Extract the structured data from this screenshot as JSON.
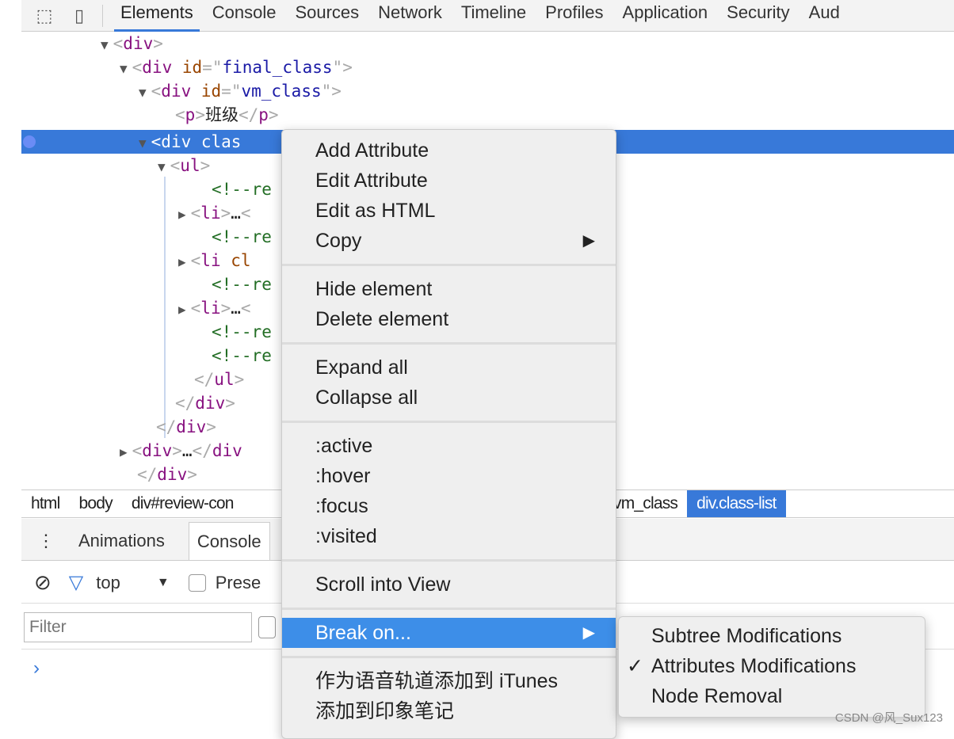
{
  "toolbar": {
    "tabs": [
      "Elements",
      "Console",
      "Sources",
      "Network",
      "Timeline",
      "Profiles",
      "Application",
      "Security",
      "Aud"
    ],
    "active": "Elements"
  },
  "tree": {
    "rows": [
      {
        "parts": [
          [
            "tri",
            "▼"
          ],
          [
            "br",
            "<"
          ],
          [
            "tag",
            "div"
          ],
          [
            "br",
            ">"
          ]
        ]
      },
      {
        "parts": [
          [
            "tri",
            "▼"
          ],
          [
            "br",
            "<"
          ],
          [
            "tag",
            "div "
          ],
          [
            "attr",
            "id"
          ],
          [
            "br",
            "=\""
          ],
          [
            "val",
            "final_class"
          ],
          [
            "br",
            "\">"
          ]
        ]
      },
      {
        "parts": [
          [
            "tri",
            "▼"
          ],
          [
            "br",
            "<"
          ],
          [
            "tag",
            "div "
          ],
          [
            "attr",
            "id"
          ],
          [
            "br",
            "=\""
          ],
          [
            "val",
            "vm_class"
          ],
          [
            "br",
            "\">"
          ]
        ]
      },
      {
        "parts": [
          [
            "br",
            "<"
          ],
          [
            "tag",
            "p"
          ],
          [
            "br",
            ">"
          ],
          [
            "txt",
            "班级"
          ],
          [
            "br",
            "</"
          ],
          [
            "tag",
            "p"
          ],
          [
            "br",
            ">"
          ]
        ]
      },
      {
        "parts": [
          [
            "tri",
            "▼"
          ],
          [
            "br",
            "<"
          ],
          [
            "tag",
            "div "
          ],
          [
            "attr",
            "clas"
          ]
        ]
      },
      {
        "parts": [
          [
            "tri",
            "▼"
          ],
          [
            "br",
            "<"
          ],
          [
            "tag",
            "ul"
          ],
          [
            "br",
            ">"
          ]
        ]
      },
      {
        "parts": [
          [
            "cm",
            "<!--re"
          ]
        ]
      },
      {
        "parts": [
          [
            "tri",
            "▶"
          ],
          [
            "br",
            "<"
          ],
          [
            "tag",
            "li"
          ],
          [
            "br",
            ">"
          ],
          [
            "txt",
            "…"
          ],
          [
            "br",
            "<"
          ]
        ]
      },
      {
        "parts": [
          [
            "cm",
            "<!--re"
          ]
        ]
      },
      {
        "parts": [
          [
            "tri",
            "▶"
          ],
          [
            "br",
            "<"
          ],
          [
            "tag",
            "li "
          ],
          [
            "attr",
            "cl"
          ]
        ]
      },
      {
        "parts": [
          [
            "cm",
            "<!--re"
          ]
        ]
      },
      {
        "parts": [
          [
            "tri",
            "▶"
          ],
          [
            "br",
            "<"
          ],
          [
            "tag",
            "li"
          ],
          [
            "br",
            ">"
          ],
          [
            "txt",
            "…"
          ],
          [
            "br",
            "<"
          ]
        ]
      },
      {
        "parts": [
          [
            "cm",
            "<!--re"
          ]
        ]
      },
      {
        "parts": [
          [
            "cm",
            "<!--re"
          ]
        ]
      },
      {
        "parts": [
          [
            "br",
            "</"
          ],
          [
            "tag",
            "ul"
          ],
          [
            "br",
            ">"
          ]
        ]
      },
      {
        "parts": [
          [
            "br",
            "</"
          ],
          [
            "tag",
            "div"
          ],
          [
            "br",
            ">"
          ]
        ]
      },
      {
        "parts": [
          [
            "br",
            "</"
          ],
          [
            "tag",
            "div"
          ],
          [
            "br",
            ">"
          ]
        ]
      },
      {
        "parts": [
          [
            "tri",
            "▶"
          ],
          [
            "br",
            "<"
          ],
          [
            "tag",
            "div"
          ],
          [
            "br",
            ">"
          ],
          [
            "txt",
            "…"
          ],
          [
            "br",
            "</"
          ],
          [
            "tag",
            "div"
          ]
        ]
      },
      {
        "parts": [
          [
            "br",
            "</"
          ],
          [
            "tag",
            "div"
          ],
          [
            "br",
            ">"
          ]
        ]
      }
    ]
  },
  "breadcrumbs": [
    "html",
    "body",
    "div#review-con",
    "div#vm_class",
    "div.class-list"
  ],
  "drawer": {
    "tabs": [
      "Animations",
      "Console"
    ],
    "active": "Console"
  },
  "console_toolbar": {
    "context": "top",
    "preserve_label": "Prese"
  },
  "filter": {
    "placeholder": "Filter",
    "value": ""
  },
  "context_menu": {
    "groups": [
      [
        {
          "label": "Add Attribute"
        },
        {
          "label": "Edit Attribute"
        },
        {
          "label": "Edit as HTML"
        },
        {
          "label": "Copy",
          "submenu": true
        }
      ],
      [
        {
          "label": "Hide element"
        },
        {
          "label": "Delete element"
        }
      ],
      [
        {
          "label": "Expand all"
        },
        {
          "label": "Collapse all"
        }
      ],
      [
        {
          "label": ":active"
        },
        {
          "label": ":hover"
        },
        {
          "label": ":focus"
        },
        {
          "label": ":visited"
        }
      ],
      [
        {
          "label": "Scroll into View"
        }
      ],
      [
        {
          "label": "Break on...",
          "submenu": true,
          "highlighted": true
        }
      ],
      [
        {
          "label": "作为语音轨道添加到 iTunes"
        },
        {
          "label": "添加到印象笔记"
        }
      ]
    ]
  },
  "submenu": [
    {
      "label": "Subtree Modifications",
      "checked": false
    },
    {
      "label": "Attributes Modifications",
      "checked": true
    },
    {
      "label": "Node Removal",
      "checked": false
    }
  ],
  "watermark": "CSDN @风_Sux123",
  "colors": {
    "accent": "#3879d9",
    "highlight": "#3d8ee8"
  }
}
